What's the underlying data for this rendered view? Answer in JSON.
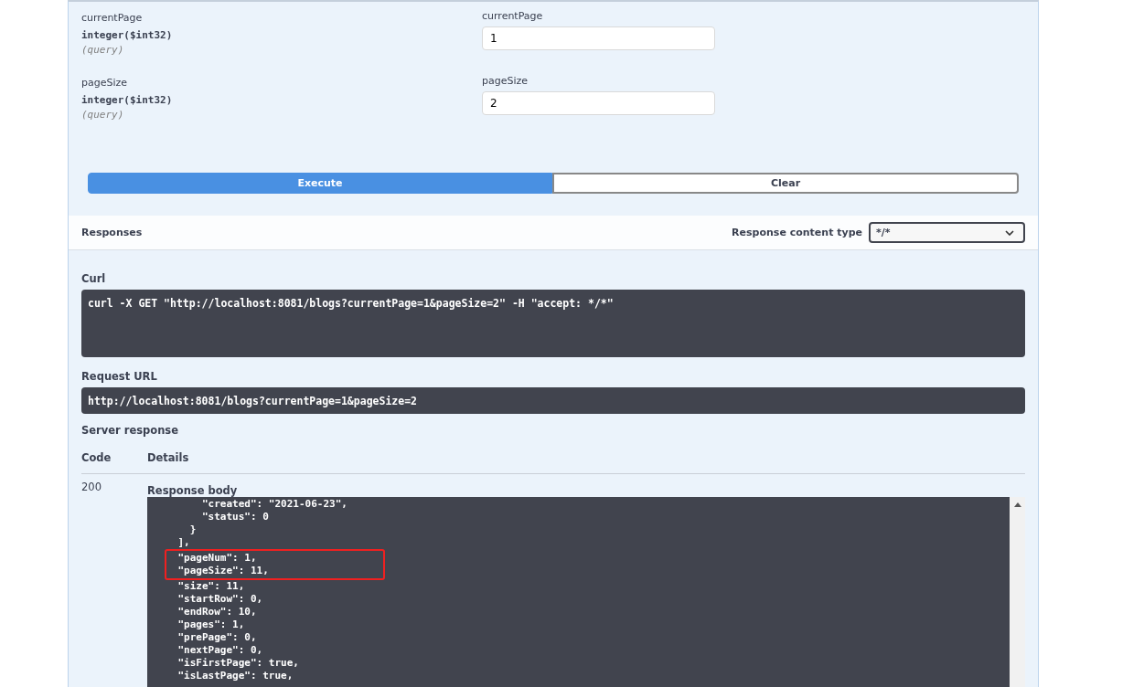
{
  "parameters": [
    {
      "name": "currentPage",
      "type": "integer($int32)",
      "location": "(query)",
      "field_label": "currentPage",
      "value": "1"
    },
    {
      "name": "pageSize",
      "type": "integer($int32)",
      "location": "(query)",
      "field_label": "pageSize",
      "value": "2"
    }
  ],
  "buttons": [
    {
      "label": "Execute",
      "kind": "primary"
    },
    {
      "label": "Clear",
      "kind": "secondary"
    }
  ],
  "responses": {
    "title": "Responses",
    "content_type_label": "Response content type",
    "content_type": "*/*"
  },
  "curl": {
    "label": "Curl",
    "command": "curl -X GET \"http://localhost:8081/blogs?currentPage=1&pageSize=2\" -H \"accept: */*\""
  },
  "request_url": {
    "label": "Request URL",
    "url": "http://localhost:8081/blogs?currentPage=1&pageSize=2"
  },
  "server_response": {
    "title": "Server response",
    "columns": [
      "Code",
      "Details"
    ],
    "code": "200",
    "body_label": "Response body",
    "body_lines": [
      {
        "text": "        \"created\": \"2021-06-23\",",
        "highlighted": false
      },
      {
        "text": "        \"status\": 0",
        "highlighted": false
      },
      {
        "text": "      }",
        "highlighted": false
      },
      {
        "text": "    ],",
        "highlighted": false
      },
      {
        "text": "    \"pageNum\": 1,",
        "highlighted": true
      },
      {
        "text": "    \"pageSize\": 11,",
        "highlighted": true
      },
      {
        "text": "    \"size\": 11,",
        "highlighted": false
      },
      {
        "text": "    \"startRow\": 0,",
        "highlighted": false
      },
      {
        "text": "    \"endRow\": 10,",
        "highlighted": false
      },
      {
        "text": "    \"pages\": 1,",
        "highlighted": false
      },
      {
        "text": "    \"prePage\": 0,",
        "highlighted": false
      },
      {
        "text": "    \"nextPage\": 0,",
        "highlighted": false
      },
      {
        "text": "    \"isFirstPage\": true,",
        "highlighted": false
      },
      {
        "text": "    \"isLastPage\": true,",
        "highlighted": false
      }
    ]
  }
}
